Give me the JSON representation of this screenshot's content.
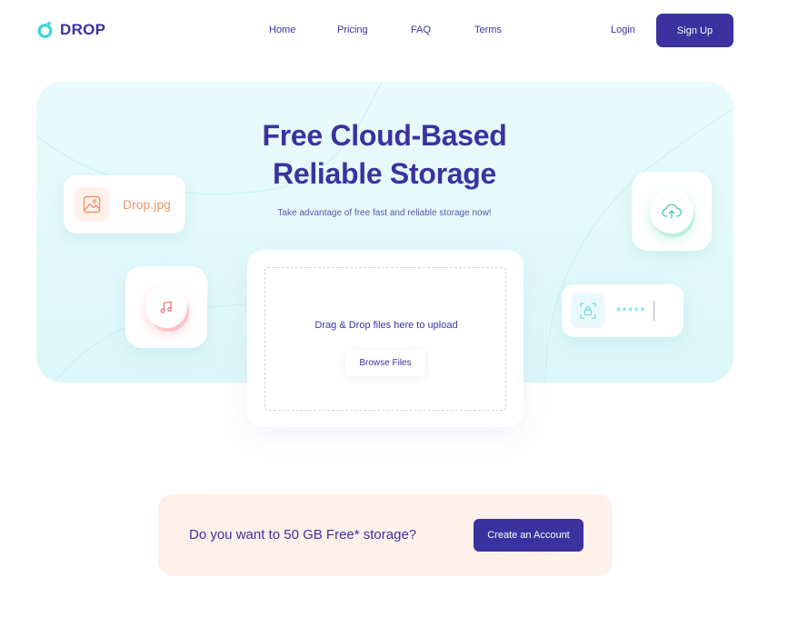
{
  "brand": {
    "name": "DROP",
    "color": "#3b32a0",
    "accent": "#3ed3d9"
  },
  "nav": {
    "links": [
      "Home",
      "Pricing",
      "FAQ",
      "Terms"
    ],
    "login": "Login",
    "signup": "Sign Up"
  },
  "hero": {
    "title_line1": "Free Cloud-Based",
    "title_line2": "Reliable Storage",
    "subtitle": "Take advantage of free fast and reliable storage now!"
  },
  "cards": {
    "file_name": "Drop.jpg",
    "file_icon": "image-icon",
    "music_icon": "music-note-icon",
    "cloud_icon": "cloud-upload-icon",
    "lock_icon": "lock-icon",
    "password_mask": "*****"
  },
  "upload": {
    "prompt": "Drag & Drop files here to upload",
    "browse_label": "Browse Files"
  },
  "cta": {
    "text": "Do you want to 50 GB Free* storage?",
    "button": "Create an Account"
  }
}
